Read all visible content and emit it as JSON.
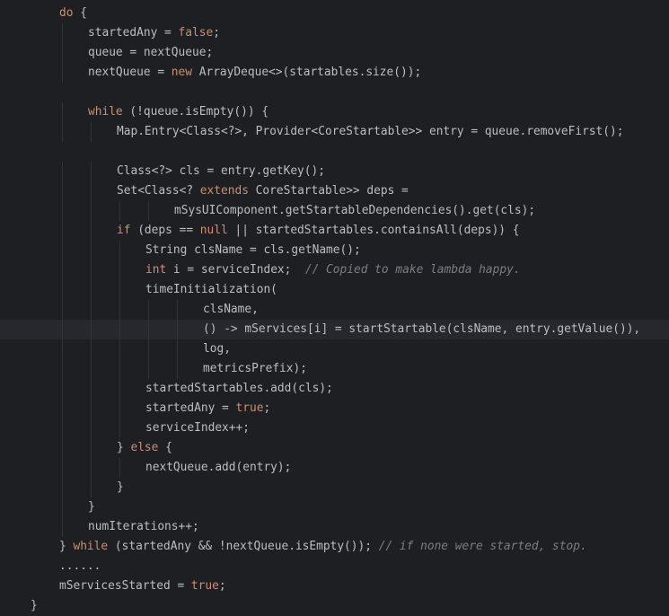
{
  "editor": {
    "colors": {
      "background": "#1e1f22",
      "current_line": "#26282e",
      "text": "#bcbec4",
      "keyword": "#cf8e6d",
      "comment": "#7a7e85"
    },
    "lines": [
      {
        "indent": 2,
        "tokens": [
          {
            "t": "do",
            "c": "kw"
          },
          {
            "t": " {",
            "c": "plain"
          }
        ]
      },
      {
        "indent": 3,
        "tokens": [
          {
            "t": "startedAny = ",
            "c": "plain"
          },
          {
            "t": "false",
            "c": "kw"
          },
          {
            "t": ";",
            "c": "plain"
          }
        ]
      },
      {
        "indent": 3,
        "tokens": [
          {
            "t": "queue = nextQueue;",
            "c": "plain"
          }
        ]
      },
      {
        "indent": 3,
        "tokens": [
          {
            "t": "nextQueue = ",
            "c": "plain"
          },
          {
            "t": "new",
            "c": "kw"
          },
          {
            "t": " ArrayDeque<>(startables.size());",
            "c": "plain"
          }
        ]
      },
      {
        "indent": 0,
        "tokens": []
      },
      {
        "indent": 3,
        "tokens": [
          {
            "t": "while",
            "c": "kw"
          },
          {
            "t": " (!queue.isEmpty()) {",
            "c": "plain"
          }
        ]
      },
      {
        "indent": 4,
        "tokens": [
          {
            "t": "Map.Entry<Class<?>, Provider<CoreStartable>> entry = queue.removeFirst();",
            "c": "plain"
          }
        ]
      },
      {
        "indent": 0,
        "tokens": []
      },
      {
        "indent": 4,
        "tokens": [
          {
            "t": "Class<?> cls = entry.getKey();",
            "c": "plain"
          }
        ]
      },
      {
        "indent": 4,
        "tokens": [
          {
            "t": "Set<Class<? ",
            "c": "plain"
          },
          {
            "t": "extends",
            "c": "kw"
          },
          {
            "t": " CoreStartable>> deps =",
            "c": "plain"
          }
        ]
      },
      {
        "indent": 6,
        "tokens": [
          {
            "t": "mSysUIComponent.getStartableDependencies().get(cls);",
            "c": "plain"
          }
        ]
      },
      {
        "indent": 4,
        "tokens": [
          {
            "t": "if",
            "c": "kw"
          },
          {
            "t": " (deps == ",
            "c": "plain"
          },
          {
            "t": "null",
            "c": "kw"
          },
          {
            "t": " || startedStartables.containsAll(deps)) {",
            "c": "plain"
          }
        ]
      },
      {
        "indent": 5,
        "tokens": [
          {
            "t": "String clsName = cls.getName();",
            "c": "plain"
          }
        ]
      },
      {
        "indent": 5,
        "tokens": [
          {
            "t": "int",
            "c": "kw"
          },
          {
            "t": " i = serviceIndex;  ",
            "c": "plain"
          },
          {
            "t": "// Copied to make lambda happy.",
            "c": "comment"
          }
        ]
      },
      {
        "indent": 5,
        "tokens": [
          {
            "t": "timeInitialization(",
            "c": "plain"
          }
        ]
      },
      {
        "indent": 7,
        "tokens": [
          {
            "t": "clsName,",
            "c": "plain"
          }
        ]
      },
      {
        "indent": 7,
        "current": true,
        "tokens": [
          {
            "t": "() -> mServices[i] = startStartable(clsName, entry.getValue()),",
            "c": "plain"
          }
        ]
      },
      {
        "indent": 7,
        "tokens": [
          {
            "t": "log,",
            "c": "plain"
          }
        ]
      },
      {
        "indent": 7,
        "tokens": [
          {
            "t": "metricsPrefix);",
            "c": "plain"
          }
        ]
      },
      {
        "indent": 5,
        "tokens": [
          {
            "t": "startedStartables.add(cls);",
            "c": "plain"
          }
        ]
      },
      {
        "indent": 5,
        "tokens": [
          {
            "t": "startedAny = ",
            "c": "plain"
          },
          {
            "t": "true",
            "c": "kw"
          },
          {
            "t": ";",
            "c": "plain"
          }
        ]
      },
      {
        "indent": 5,
        "tokens": [
          {
            "t": "serviceIndex++;",
            "c": "plain"
          }
        ]
      },
      {
        "indent": 4,
        "tokens": [
          {
            "t": "} ",
            "c": "plain"
          },
          {
            "t": "else",
            "c": "kw"
          },
          {
            "t": " {",
            "c": "plain"
          }
        ]
      },
      {
        "indent": 5,
        "tokens": [
          {
            "t": "nextQueue.add(entry);",
            "c": "plain"
          }
        ]
      },
      {
        "indent": 4,
        "tokens": [
          {
            "t": "}",
            "c": "plain"
          }
        ]
      },
      {
        "indent": 3,
        "tokens": [
          {
            "t": "}",
            "c": "plain"
          }
        ]
      },
      {
        "indent": 3,
        "tokens": [
          {
            "t": "numIterations++;",
            "c": "plain"
          }
        ]
      },
      {
        "indent": 2,
        "tokens": [
          {
            "t": "} ",
            "c": "plain"
          },
          {
            "t": "while",
            "c": "kw"
          },
          {
            "t": " (startedAny && !nextQueue.isEmpty()); ",
            "c": "plain"
          },
          {
            "t": "// if none were started, stop.",
            "c": "comment"
          }
        ]
      },
      {
        "indent": 2,
        "tokens": [
          {
            "t": "......",
            "c": "plain"
          }
        ]
      },
      {
        "indent": 2,
        "tokens": [
          {
            "t": "mServicesStarted = ",
            "c": "plain"
          },
          {
            "t": "true",
            "c": "kw"
          },
          {
            "t": ";",
            "c": "plain"
          }
        ]
      },
      {
        "indent": 1,
        "tokens": [
          {
            "t": "}",
            "c": "plain"
          }
        ]
      }
    ]
  }
}
